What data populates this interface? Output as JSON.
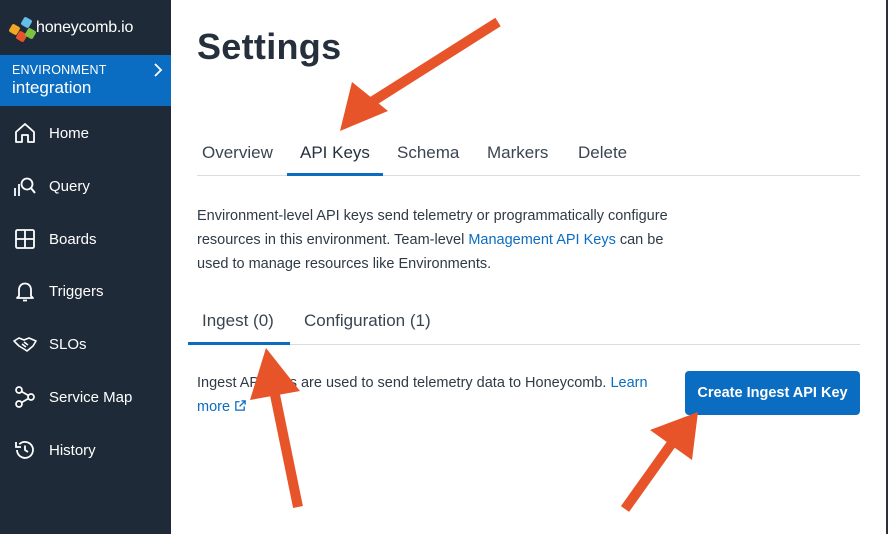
{
  "brand": {
    "logo_text": "honeycomb.io"
  },
  "environment": {
    "label": "ENVIRONMENT",
    "name": "integration"
  },
  "sidebar": {
    "items": [
      {
        "label": "Home",
        "icon": "home-icon"
      },
      {
        "label": "Query",
        "icon": "query-icon"
      },
      {
        "label": "Boards",
        "icon": "boards-icon"
      },
      {
        "label": "Triggers",
        "icon": "bell-icon"
      },
      {
        "label": "SLOs",
        "icon": "handshake-icon"
      },
      {
        "label": "Service Map",
        "icon": "service-map-icon"
      },
      {
        "label": "History",
        "icon": "history-icon"
      }
    ]
  },
  "page": {
    "title": "Settings"
  },
  "tabs": [
    {
      "label": "Overview"
    },
    {
      "label": "API Keys",
      "active": true
    },
    {
      "label": "Schema"
    },
    {
      "label": "Markers"
    },
    {
      "label": "Delete"
    }
  ],
  "description": {
    "text_before": "Environment-level API keys send telemetry or programmatically configure resources in this environment. Team-level ",
    "link": "Management API Keys",
    "text_after": " can be used to manage resources like Environments."
  },
  "subtabs": [
    {
      "label": "Ingest (0)",
      "active": true
    },
    {
      "label": "Configuration (1)"
    }
  ],
  "ingest": {
    "text": "Ingest API keys are used to send telemetry data to Honeycomb. ",
    "link": "Learn more",
    "button": "Create Ingest API Key"
  },
  "colors": {
    "sidebar_bg": "#1f2a38",
    "accent": "#0b6dc1",
    "annotation_arrow": "#e8542a"
  }
}
